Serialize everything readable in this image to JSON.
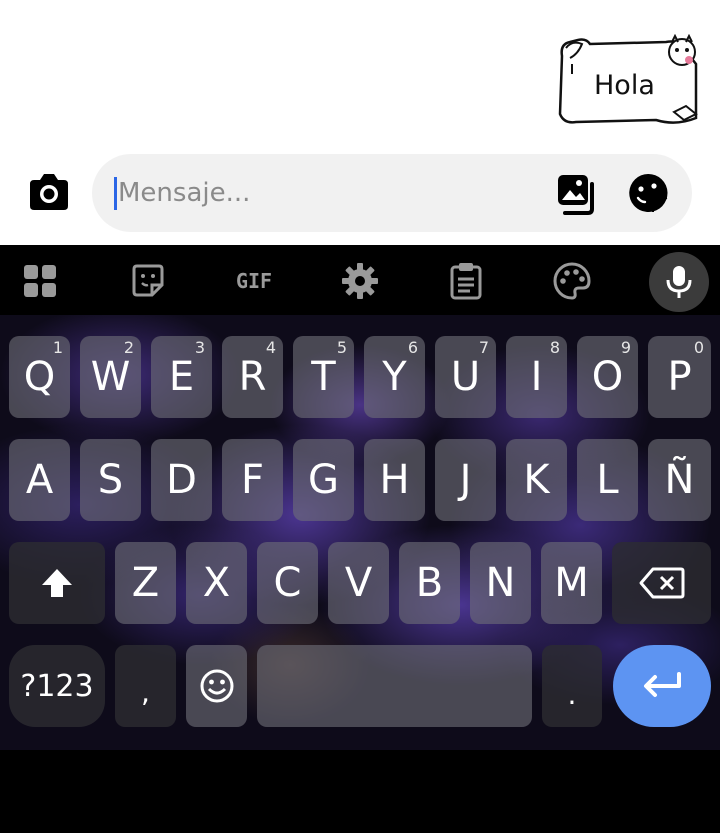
{
  "chat": {
    "sticker_text": "Hola"
  },
  "composer": {
    "placeholder": "Mensaje..."
  },
  "toolbar": {
    "gif_label": "GIF"
  },
  "keyboard": {
    "row1": [
      {
        "label": "Q",
        "hint": "1"
      },
      {
        "label": "W",
        "hint": "2"
      },
      {
        "label": "E",
        "hint": "3"
      },
      {
        "label": "R",
        "hint": "4"
      },
      {
        "label": "T",
        "hint": "5"
      },
      {
        "label": "Y",
        "hint": "6"
      },
      {
        "label": "U",
        "hint": "7"
      },
      {
        "label": "I",
        "hint": "8"
      },
      {
        "label": "O",
        "hint": "9"
      },
      {
        "label": "P",
        "hint": "0"
      }
    ],
    "row2": [
      "A",
      "S",
      "D",
      "F",
      "G",
      "H",
      "J",
      "K",
      "L",
      "Ñ"
    ],
    "row3": [
      "Z",
      "X",
      "C",
      "V",
      "B",
      "N",
      "M"
    ],
    "symbols_label": "?123",
    "comma_label": ",",
    "period_label": "."
  },
  "colors": {
    "enter_key": "#5d94f2",
    "caret": "#2b66e6"
  },
  "icons": [
    "camera-icon",
    "gallery-icon",
    "sticker-face-icon",
    "apps-grid-icon",
    "sticker-icon",
    "gif-icon",
    "settings-gear-icon",
    "clipboard-icon",
    "palette-icon",
    "microphone-icon",
    "shift-icon",
    "backspace-icon",
    "emoji-icon",
    "enter-icon"
  ]
}
